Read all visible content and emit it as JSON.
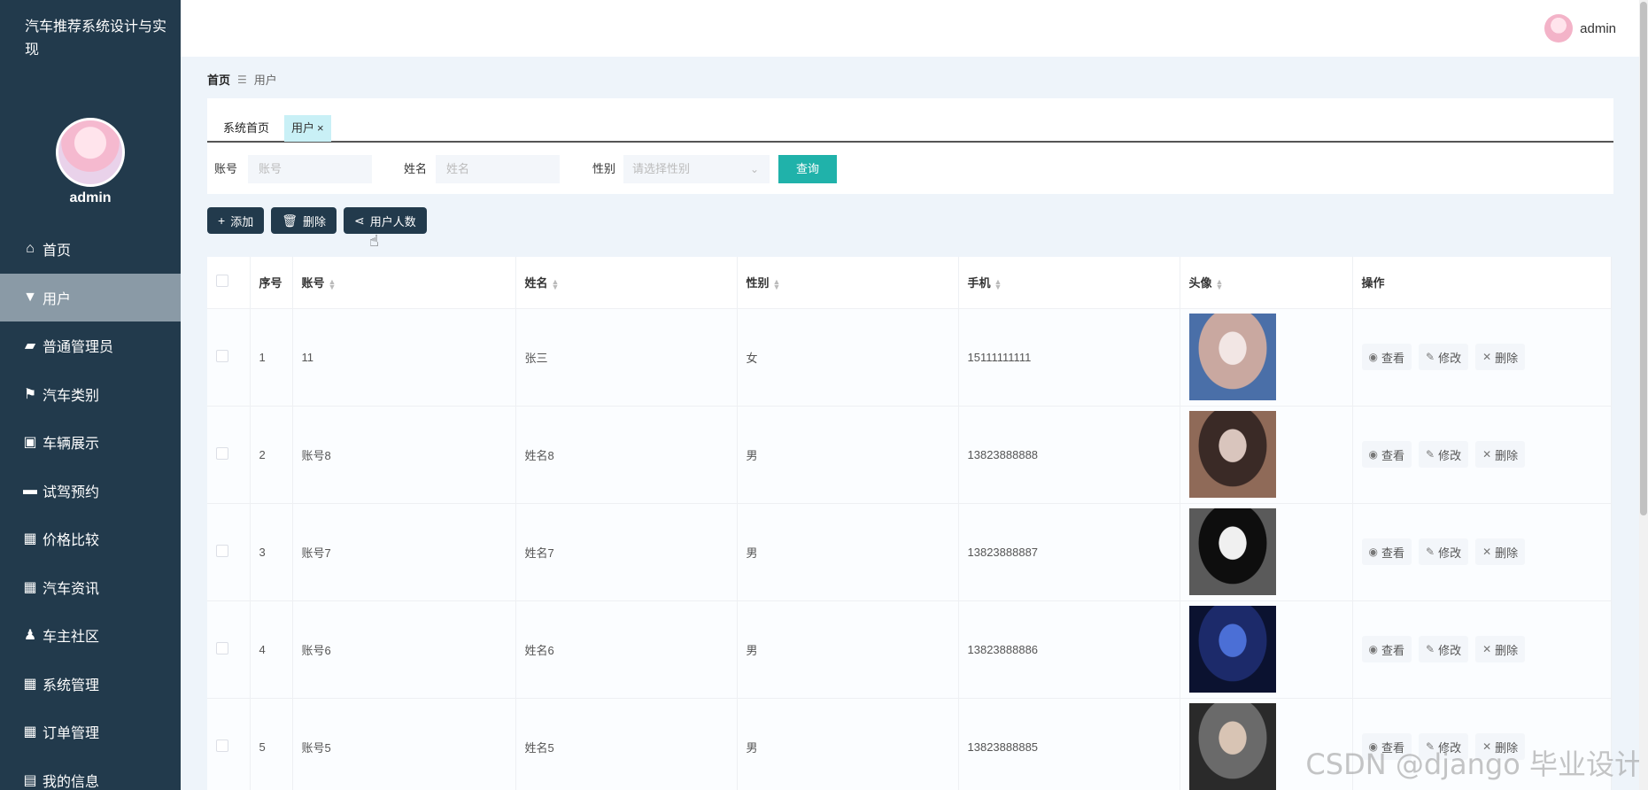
{
  "app": {
    "title": "汽车推荐系统设计与实现",
    "username": "admin"
  },
  "sidebar": {
    "items": [
      {
        "label": "首页",
        "icon": "home-icon",
        "glyph": "⌂"
      },
      {
        "label": "用户",
        "icon": "user-badge-icon",
        "glyph": "▼"
      },
      {
        "label": "普通管理员",
        "icon": "chat-icon",
        "glyph": "▰"
      },
      {
        "label": "汽车类别",
        "icon": "flag-icon",
        "glyph": "⚑"
      },
      {
        "label": "车辆展示",
        "icon": "clipboard-icon",
        "glyph": "▣"
      },
      {
        "label": "试驾预约",
        "icon": "monitor-icon",
        "glyph": "▬"
      },
      {
        "label": "价格比较",
        "icon": "grid-icon",
        "glyph": "▦"
      },
      {
        "label": "汽车资讯",
        "icon": "grid-icon",
        "glyph": "▦"
      },
      {
        "label": "车主社区",
        "icon": "person-icon",
        "glyph": "♟"
      },
      {
        "label": "系统管理",
        "icon": "grid-icon",
        "glyph": "▦"
      },
      {
        "label": "订单管理",
        "icon": "grid-nine-icon",
        "glyph": "▦"
      },
      {
        "label": "我的信息",
        "icon": "id-card-icon",
        "glyph": "▤"
      }
    ],
    "active_index": 1
  },
  "breadcrumb": {
    "home": "首页",
    "separator": "☰",
    "current": "用户"
  },
  "tabs": [
    {
      "label": "系统首页",
      "closable": false
    },
    {
      "label": "用户",
      "closable": true,
      "close": "×"
    }
  ],
  "search": {
    "account_label": "账号",
    "account_placeholder": "账号",
    "name_label": "姓名",
    "name_placeholder": "姓名",
    "gender_label": "性别",
    "gender_placeholder": "请选择性别",
    "query_button": "查询"
  },
  "actions": {
    "add": "添加",
    "delete": "删除",
    "stats": "用户人数"
  },
  "table": {
    "columns": [
      "序号",
      "账号",
      "姓名",
      "性别",
      "手机",
      "头像",
      "操作"
    ],
    "op_labels": {
      "view": "查看",
      "edit": "修改",
      "delete": "删除"
    },
    "rows": [
      {
        "index": "1",
        "account": "11",
        "name": "张三",
        "gender": "女",
        "phone": "15111111111",
        "avatar_colors": [
          "#c9a8a0",
          "#f2e6e4",
          "#4a6fa8"
        ]
      },
      {
        "index": "2",
        "account": "账号8",
        "name": "姓名8",
        "gender": "男",
        "phone": "13823888888",
        "avatar_colors": [
          "#3a2a26",
          "#d9c5bd",
          "#8f6a58"
        ]
      },
      {
        "index": "3",
        "account": "账号7",
        "name": "姓名7",
        "gender": "男",
        "phone": "13823888887",
        "avatar_colors": [
          "#0e0e0e",
          "#f0f0f0",
          "#5a5a5a"
        ]
      },
      {
        "index": "4",
        "account": "账号6",
        "name": "姓名6",
        "gender": "男",
        "phone": "13823888886",
        "avatar_colors": [
          "#1c2a6a",
          "#4b6fd6",
          "#0b1230"
        ]
      },
      {
        "index": "5",
        "account": "账号5",
        "name": "姓名5",
        "gender": "男",
        "phone": "13823888885",
        "avatar_colors": [
          "#6a6a6a",
          "#d8c4b4",
          "#2a2a2a"
        ]
      }
    ]
  },
  "watermark": "CSDN @django 毕业设计",
  "colors": {
    "sidebar": "#223a4c",
    "accent": "#20b2aa",
    "active_menu": "#8a9aa6",
    "tab_active": "#c9f0f6"
  }
}
